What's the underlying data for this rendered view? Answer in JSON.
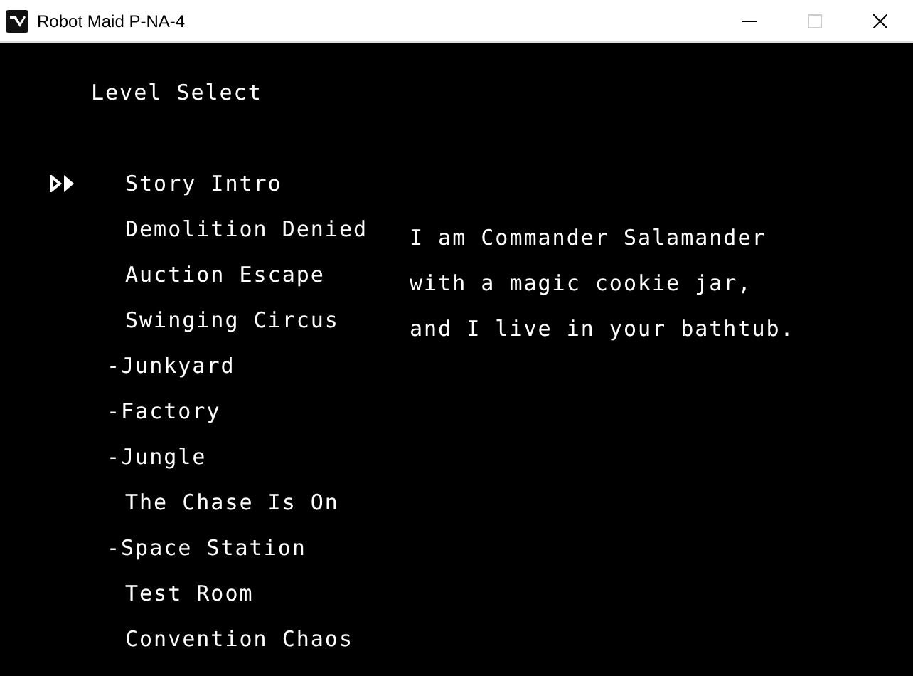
{
  "window": {
    "title": "Robot Maid P-NA-4",
    "maximize_disabled": true
  },
  "heading": "Level Select",
  "levels": [
    {
      "label": "Story Intro",
      "kind": "level",
      "selected": true
    },
    {
      "label": "Demolition Denied",
      "kind": "level",
      "selected": false
    },
    {
      "label": "Auction Escape",
      "kind": "level",
      "selected": false
    },
    {
      "label": "Swinging Circus",
      "kind": "level",
      "selected": false
    },
    {
      "label": "-Junkyard",
      "kind": "section",
      "selected": false
    },
    {
      "label": "-Factory",
      "kind": "section",
      "selected": false
    },
    {
      "label": "-Jungle",
      "kind": "section",
      "selected": false
    },
    {
      "label": "The Chase Is On",
      "kind": "level",
      "selected": false
    },
    {
      "label": "-Space Station",
      "kind": "section",
      "selected": false
    },
    {
      "label": "Test Room",
      "kind": "level",
      "selected": false
    },
    {
      "label": "Convention Chaos",
      "kind": "level",
      "selected": false
    }
  ],
  "dialogue": [
    "I am Commander Salamander",
    "with a magic cookie jar,",
    "and I live in your bathtub."
  ]
}
